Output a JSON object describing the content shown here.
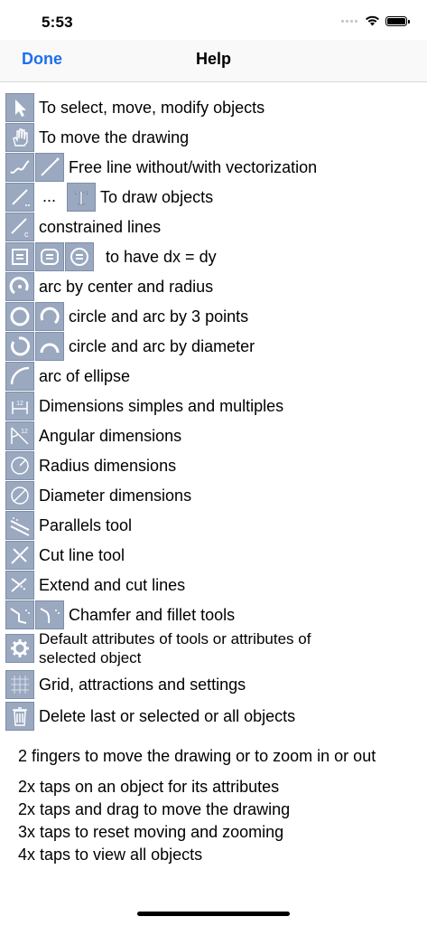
{
  "status": {
    "time": "5:53"
  },
  "nav": {
    "done_label": "Done",
    "title": "Help"
  },
  "rows": {
    "select": "To select, move, modify objects",
    "move": "To move the drawing",
    "freeline": "Free line without/with vectorization",
    "draw_dots": "...",
    "draw": "To draw objects",
    "constrained": "constrained lines",
    "dxdy": "to have dx = dy",
    "arc_center": "arc by center and radius",
    "circle3": "circle and arc by 3 points",
    "circle_diam": "circle and arc by diameter",
    "ellipse": "arc of ellipse",
    "dimensions": "Dimensions simples and multiples",
    "angular": "Angular dimensions",
    "radius": "Radius dimensions",
    "diameter": "Diameter dimensions",
    "parallels": "Parallels tool",
    "cutline": "Cut line tool",
    "extend": "Extend and cut lines",
    "chamfer": "Chamfer and fillet tools",
    "defaults": "Default attributes of tools or attributes of selected object",
    "grid": "Grid, attractions and settings",
    "delete": "Delete last or selected or all objects"
  },
  "notes": {
    "zoom": "2 fingers to move the drawing or to zoom in or out",
    "tap2": "2x taps on an object for its attributes",
    "tapdrag": "2x taps and drag to move the drawing",
    "tap3": "3x taps to reset moving and zooming",
    "tap4": "4x taps to view all objects"
  },
  "icons": {
    "colors": {
      "tile": "#9aa8c0",
      "glyph": "#ffffff",
      "accent": "#1f6ff0"
    }
  }
}
